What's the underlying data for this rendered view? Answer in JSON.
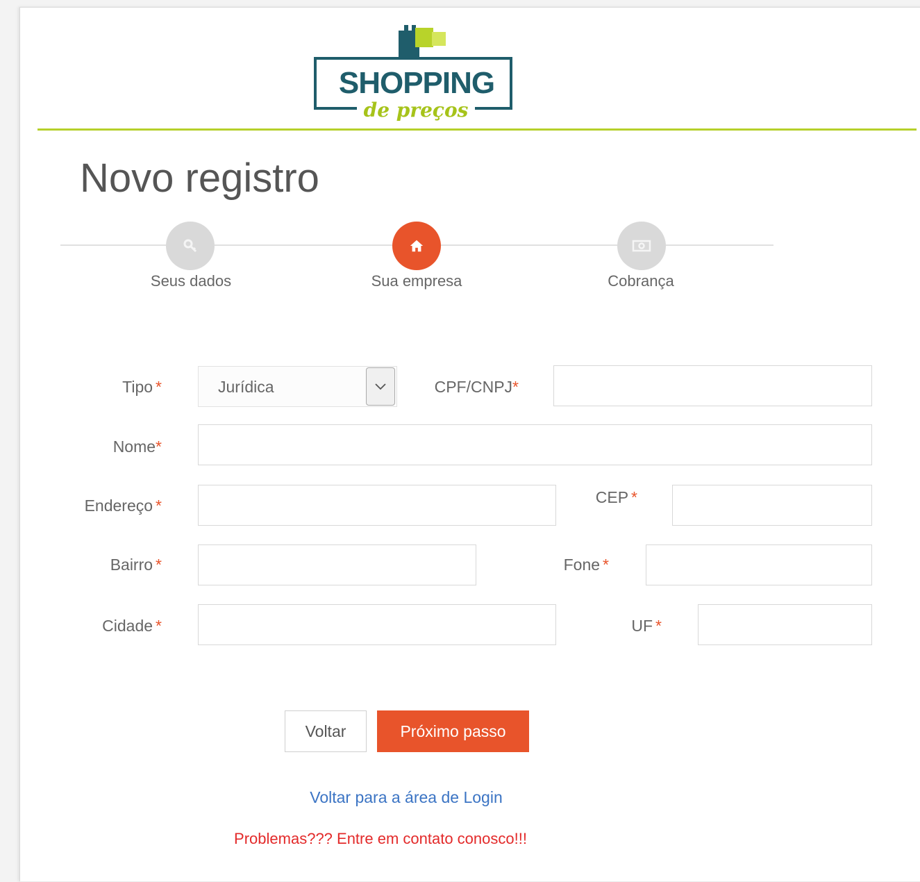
{
  "logo": {
    "word": "SHOPPING",
    "script": "de preços"
  },
  "page_title": "Novo registro",
  "steps": [
    {
      "label": "Seus dados",
      "icon": "key-icon",
      "state": "done"
    },
    {
      "label": "Sua empresa",
      "icon": "home-icon",
      "state": "active"
    },
    {
      "label": "Cobrança",
      "icon": "money-icon",
      "state": "pending"
    }
  ],
  "form": {
    "tipo": {
      "label": "Tipo",
      "required_mark": "*",
      "value": "Jurídica"
    },
    "cpf_cnpj": {
      "label": "CPF/CNPJ",
      "required_mark": "*",
      "value": ""
    },
    "nome": {
      "label": "Nome",
      "required_mark": "*",
      "value": ""
    },
    "endereco": {
      "label": "Endereço",
      "required_mark": "*",
      "value": ""
    },
    "cep": {
      "label": "CEP",
      "required_mark": "*",
      "value": ""
    },
    "bairro": {
      "label": "Bairro",
      "required_mark": "*",
      "value": ""
    },
    "fone": {
      "label": "Fone",
      "required_mark": "*",
      "value": ""
    },
    "cidade": {
      "label": "Cidade",
      "required_mark": "*",
      "value": ""
    },
    "uf": {
      "label": "UF",
      "required_mark": "*",
      "value": ""
    }
  },
  "buttons": {
    "back": "Voltar",
    "next": "Próximo passo"
  },
  "links": {
    "login": "Voltar para a área de Login",
    "problems": "Problemas??? Entre em contato conosco!!!"
  },
  "colors": {
    "accent": "#e8542b",
    "brand_dark": "#1f5d6b",
    "brand_green": "#b5d02a",
    "link": "#3b74c4",
    "alert": "#e32a2a"
  }
}
